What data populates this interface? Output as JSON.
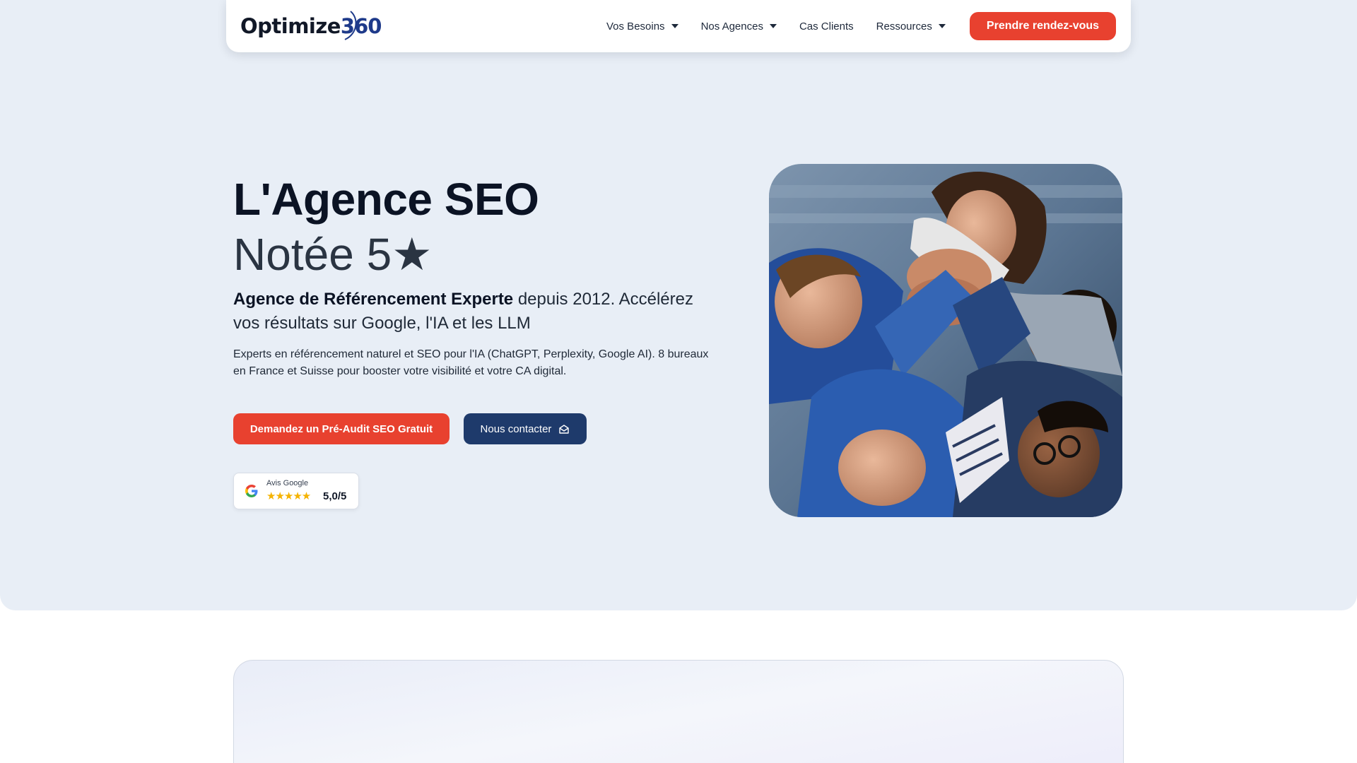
{
  "brand": {
    "name_text": "Optimize",
    "name_number": "360"
  },
  "nav": {
    "items": [
      {
        "label": "Vos Besoins",
        "dropdown": true
      },
      {
        "label": "Nos Agences",
        "dropdown": true
      },
      {
        "label": "Cas Clients",
        "dropdown": false
      },
      {
        "label": "Ressources",
        "dropdown": true
      }
    ],
    "cta_label": "Prendre rendez-vous"
  },
  "hero": {
    "title": "L'Agence SEO",
    "subtitle": "Notée 5★",
    "tagline_bold": "Agence de Référencement Experte",
    "tagline_rest": " depuis 2012. Accélérez vos résultats sur Google, l'IA et les LLM",
    "description": "Experts en référencement naturel et SEO pour l'IA (ChatGPT, Perplexity, Google AI). 8 bureaux en France et Suisse pour booster votre visibilité et votre CA digital.",
    "primary_button": "Demandez un Pré-Audit SEO Gratuit",
    "secondary_button": "Nous contacter",
    "secondary_icon": "envelope-open-icon"
  },
  "review_badge": {
    "label": "Avis Google",
    "stars": "★★★★★",
    "rating": 5.0,
    "score_text": "5,0/5",
    "icon": "google-g-icon"
  },
  "colors": {
    "accent_red": "#e8412f",
    "navy": "#1e3a6b",
    "hero_background": "#e8eef6",
    "star_yellow": "#f5b301"
  }
}
